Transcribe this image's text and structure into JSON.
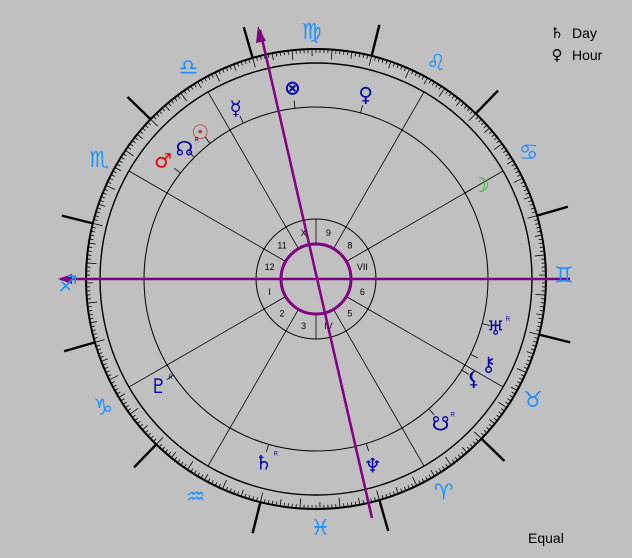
{
  "legend": {
    "day": {
      "symbol": "♄",
      "label": "Day"
    },
    "hour": {
      "symbol": "♀",
      "label": "Hour"
    }
  },
  "house_system": "Equal",
  "zodiac_signs": [
    {
      "name": "aries",
      "glyph": "♈︎"
    },
    {
      "name": "taurus",
      "glyph": "♉︎"
    },
    {
      "name": "gemini",
      "glyph": "♊︎"
    },
    {
      "name": "cancer",
      "glyph": "♋︎"
    },
    {
      "name": "leo",
      "glyph": "♌︎"
    },
    {
      "name": "virgo",
      "glyph": "♍︎"
    },
    {
      "name": "libra",
      "glyph": "♎︎"
    },
    {
      "name": "scorpio",
      "glyph": "♏︎"
    },
    {
      "name": "sagittarius",
      "glyph": "♐︎"
    },
    {
      "name": "capricorn",
      "glyph": "♑︎"
    },
    {
      "name": "aquarius",
      "glyph": "♒︎"
    },
    {
      "name": "pisces",
      "glyph": "♓︎"
    }
  ],
  "houses": [
    "I",
    "2",
    "3",
    "IV",
    "5",
    "6",
    "VII",
    "8",
    "9",
    "X",
    "11",
    "12"
  ],
  "planets": [
    {
      "name": "sun",
      "glyph": "☉",
      "color": "#cc3333",
      "note": ""
    },
    {
      "name": "moon",
      "glyph": "☽︎",
      "color": "#22bb22",
      "note": ""
    },
    {
      "name": "mercury",
      "glyph": "☿︎",
      "color": "#0000aa",
      "note": ""
    },
    {
      "name": "venus",
      "glyph": "♀︎",
      "color": "#0000aa",
      "note": ""
    },
    {
      "name": "mars",
      "glyph": "♂︎",
      "color": "#ee0000",
      "note": ""
    },
    {
      "name": "saturn",
      "glyph": "♄︎",
      "color": "#0000aa",
      "note": "R"
    },
    {
      "name": "uranus",
      "glyph": "♅︎",
      "color": "#0000aa",
      "note": "R"
    },
    {
      "name": "neptune",
      "glyph": "♆︎",
      "color": "#0000aa",
      "note": ""
    },
    {
      "name": "pluto",
      "glyph": "♇︎",
      "color": "#0000aa",
      "note": "R"
    },
    {
      "name": "north-node",
      "glyph": "☊︎",
      "color": "#0000aa",
      "note": "R"
    },
    {
      "name": "south-node",
      "glyph": "☋︎",
      "color": "#0000aa",
      "note": "R"
    },
    {
      "name": "chiron",
      "glyph": "⚷︎",
      "color": "#0000aa",
      "note": ""
    },
    {
      "name": "lilith",
      "glyph": "⚸︎",
      "color": "#0000aa",
      "note": ""
    },
    {
      "name": "part-of-fortune",
      "glyph": "⊗",
      "color": "#0000aa",
      "note": ""
    }
  ],
  "colors": {
    "background": "#c0c0c0",
    "axis": "#800080",
    "sign_glyph": "#1e90ff",
    "planet": "#0000aa"
  }
}
